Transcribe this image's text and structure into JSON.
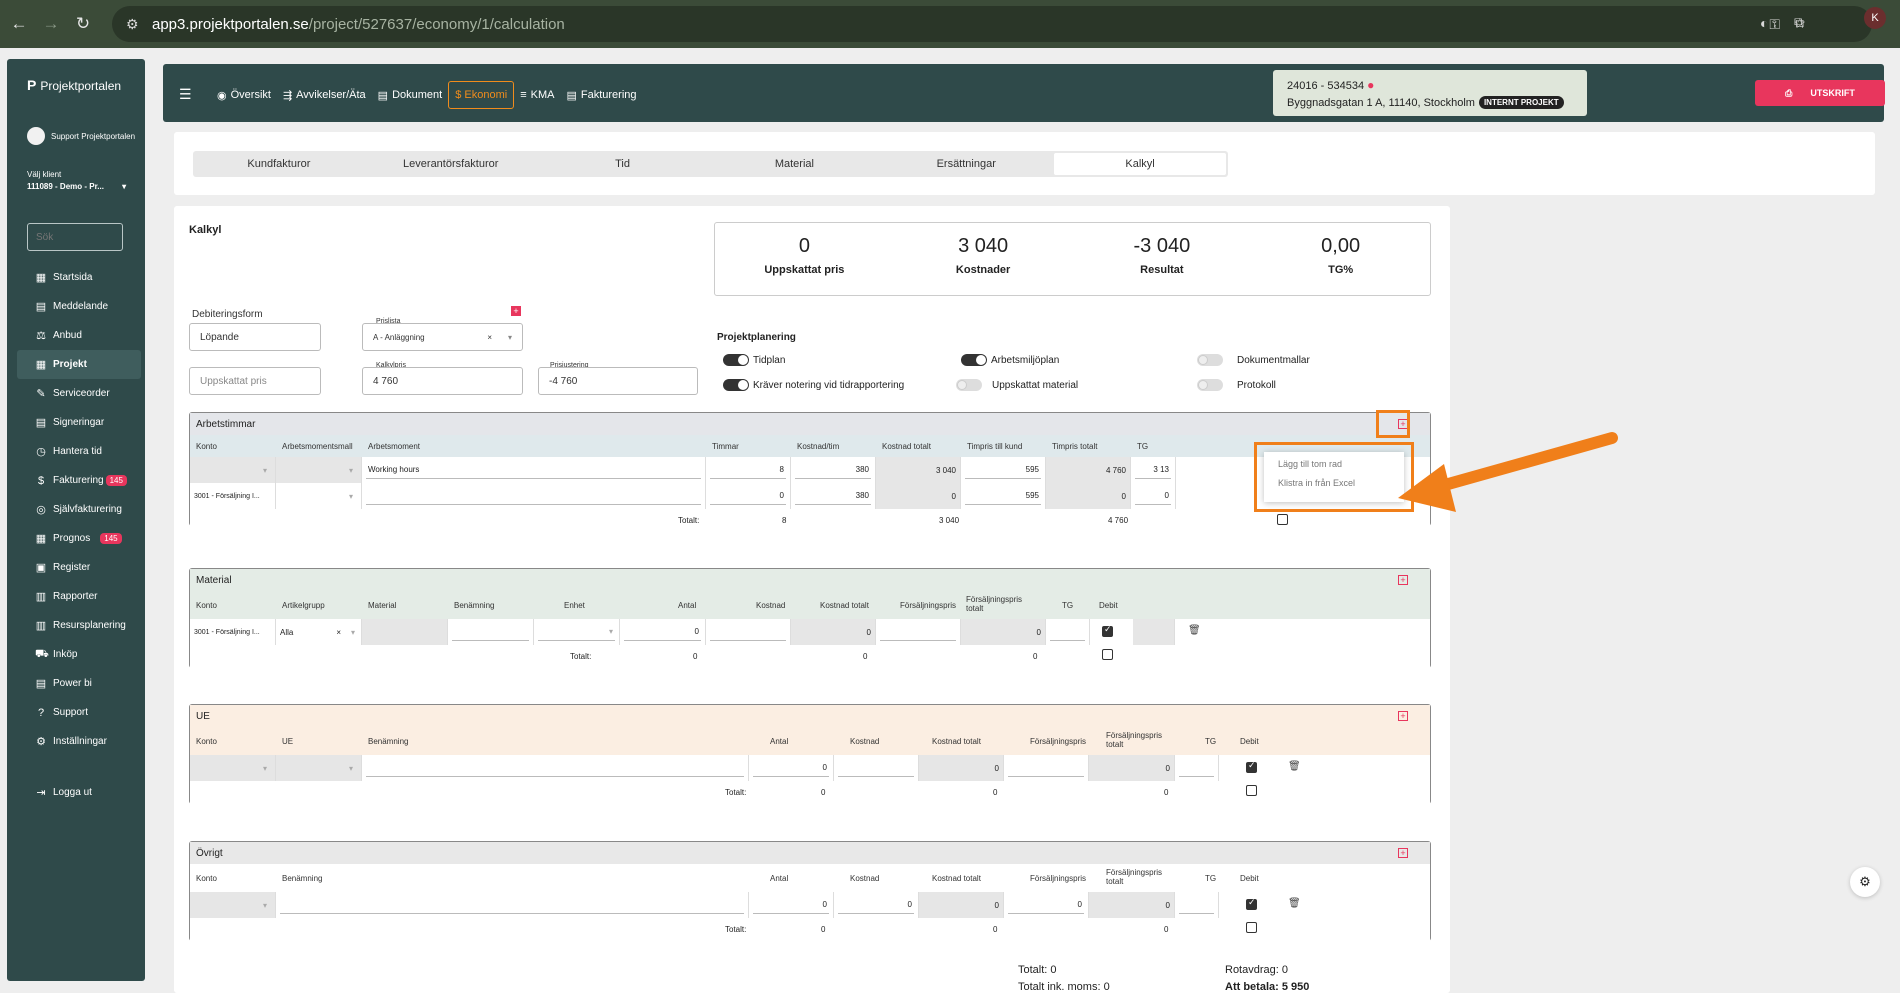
{
  "browser": {
    "url_host": "app3.projektportalen.se",
    "url_path": "/project/527637/economy/1/calculation",
    "avatar": "K"
  },
  "sidebar": {
    "logo": "Projektportalen",
    "user": "Support Projektportalen",
    "client_label": "Välj klient",
    "client_value": "111089 - Demo - Pr...",
    "search_placeholder": "Sök",
    "items": [
      {
        "label": "Startsida",
        "icon": "home-icon"
      },
      {
        "label": "Meddelande",
        "icon": "message-icon"
      },
      {
        "label": "Anbud",
        "icon": "gavel-icon"
      },
      {
        "label": "Projekt",
        "icon": "grid-icon"
      },
      {
        "label": "Serviceorder",
        "icon": "wrench-icon"
      },
      {
        "label": "Signeringar",
        "icon": "signature-icon"
      },
      {
        "label": "Hantera tid",
        "icon": "clock-icon"
      },
      {
        "label": "Fakturering",
        "icon": "dollar-icon",
        "badge": "145"
      },
      {
        "label": "Självfakturering",
        "icon": "coin-icon"
      },
      {
        "label": "Prognos",
        "icon": "grid-icon",
        "badge": "145"
      },
      {
        "label": "Register",
        "icon": "register-icon"
      },
      {
        "label": "Rapporter",
        "icon": "calendar-icon"
      },
      {
        "label": "Resursplanering",
        "icon": "calendar-icon"
      },
      {
        "label": "Inköp",
        "icon": "cart-icon"
      },
      {
        "label": "Power bi",
        "icon": "powerbi-icon"
      },
      {
        "label": "Support",
        "icon": "help-icon"
      },
      {
        "label": "Inställningar",
        "icon": "gear-icon"
      },
      {
        "label": "Logga ut",
        "icon": "logout-icon"
      }
    ]
  },
  "topnav": {
    "tabs": [
      "Översikt",
      "Avvikelser/Äta",
      "Dokument",
      "$ Ekonomi",
      "KMA",
      "Fakturering"
    ],
    "project_id": "24016 - 534534",
    "project_address": "Byggnadsgatan 1 A, 11140, Stockholm",
    "project_badge": "INTERNT PROJEKT",
    "print_label": "UTSKRIFT"
  },
  "subnav": [
    "Kundfakturor",
    "Leverantörsfakturor",
    "Tid",
    "Material",
    "Ersättningar",
    "Kalkyl"
  ],
  "kalkyl": {
    "title": "Kalkyl",
    "stats": [
      {
        "value": "0",
        "label": "Uppskattat pris"
      },
      {
        "value": "3 040",
        "label": "Kostnader"
      },
      {
        "value": "-3 040",
        "label": "Resultat"
      },
      {
        "value": "0,00",
        "label": "TG%"
      }
    ],
    "debiteringsform_label": "Debiteringsform",
    "debiteringsform_value": "Löpande",
    "prislista_label": "Prislista",
    "prislista_value": "A - Anläggning",
    "uppskattat_placeholder": "Uppskattat pris",
    "kalkylpris_label": "Kalkylpris",
    "kalkylpris_value": "4 760",
    "prisjustering_label": "Prisjustering",
    "prisjustering_value": "-4 760",
    "projektplanering_title": "Projektplanering",
    "toggles": [
      {
        "label": "Tidplan",
        "on": true
      },
      {
        "label": "Arbetsmiljöplan",
        "on": true
      },
      {
        "label": "Dokumentmallar",
        "on": false
      },
      {
        "label": "Kräver notering vid tidrapportering",
        "on": true
      },
      {
        "label": "Uppskattat material",
        "on": false
      },
      {
        "label": "Protokoll",
        "on": false
      }
    ]
  },
  "arbetstimmar": {
    "title": "Arbetstimmar",
    "cols": [
      "Konto",
      "Arbetsmomentsmall",
      "Arbetsmoment",
      "Timmar",
      "Kostnad/tim",
      "Kostnad totalt",
      "Timpris till kund",
      "Timpris totalt",
      "TG"
    ],
    "row1": {
      "moment": "Working hours",
      "timmar": "8",
      "kostnad_tim": "380",
      "kostnad_tot": "3 040",
      "timpris": "595",
      "timpris_tot": "4 760",
      "tg": "3 13"
    },
    "row2": {
      "konto": "3001 - Försäljning I...",
      "timmar": "0",
      "kostnad_tim": "380",
      "kostnad_tot": "0",
      "timpris": "595",
      "timpris_tot": "0",
      "tg": "0"
    },
    "total_label": "Totalt:",
    "total_timmar": "8",
    "total_kostnad": "3 040",
    "total_timpris": "4 760"
  },
  "dropdown": {
    "item1": "Lägg till tom rad",
    "item2": "Klistra in från Excel"
  },
  "material": {
    "title": "Material",
    "cols": [
      "Konto",
      "Artikelgrupp",
      "Material",
      "Benämning",
      "Enhet",
      "Antal",
      "Kostnad",
      "Kostnad totalt",
      "Försäljningspris",
      "Försäljningspris totalt",
      "TG",
      "Debit"
    ],
    "row": {
      "konto": "3001 - Försäljning I...",
      "grupp": "Alla",
      "antal": "0",
      "kostnad_tot": "0",
      "fp_tot": "0"
    },
    "total_label": "Totalt:",
    "totals": [
      "0",
      "0",
      "0"
    ]
  },
  "ue": {
    "title": "UE",
    "cols": [
      "Konto",
      "UE",
      "Benämning",
      "Antal",
      "Kostnad",
      "Kostnad totalt",
      "Försäljningspris",
      "Försäljningspris totalt",
      "TG",
      "Debit"
    ],
    "row": {
      "antal": "0",
      "kostnad_tot": "0",
      "fp_tot": "0"
    },
    "total_label": "Totalt:",
    "totals": [
      "0",
      "0",
      "0"
    ]
  },
  "ovrigt": {
    "title": "Övrigt",
    "cols": [
      "Konto",
      "Benämning",
      "Antal",
      "Kostnad",
      "Kostnad totalt",
      "Försäljningspris",
      "Försäljningspris totalt",
      "TG",
      "Debit"
    ],
    "row": {
      "antal": "0",
      "kostnad": "0",
      "kostnad_tot": "0",
      "fp": "0",
      "fp_tot": "0"
    },
    "total_label": "Totalt:",
    "totals": [
      "0",
      "0",
      "0"
    ]
  },
  "summary": {
    "totalt": "Totalt: 0",
    "totalt_moms": "Totalt ink. moms: 0",
    "rotavdrag": "Rotavdrag: 0",
    "att_betala": "Att betala: 5 950"
  },
  "colors": {
    "accent": "#e8365d",
    "highlight": "#f07f1a",
    "nav": "#2f4a4a"
  }
}
